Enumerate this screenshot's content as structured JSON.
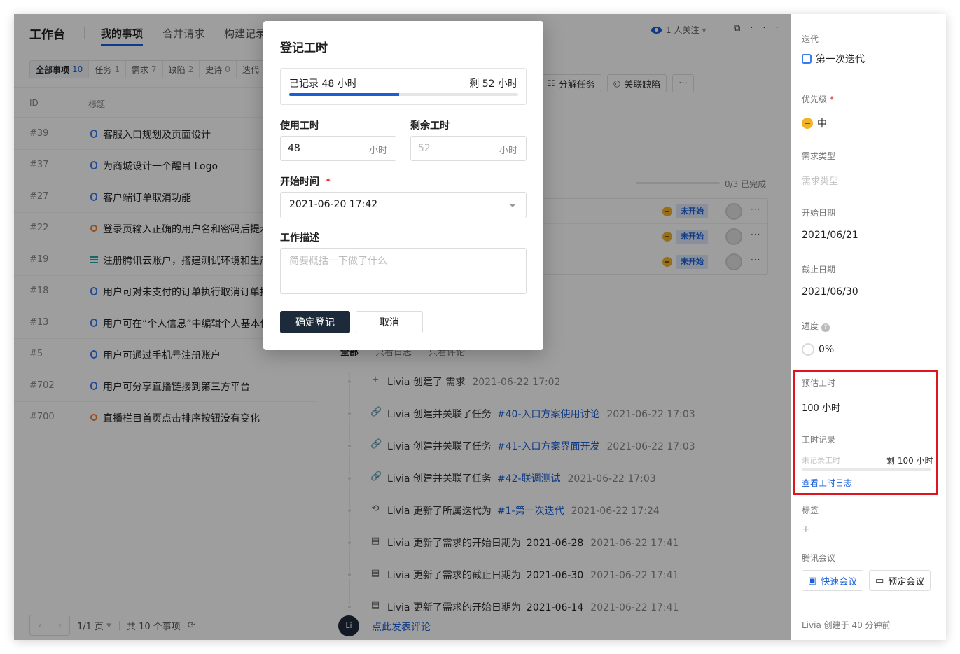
{
  "app": {
    "brand": "工作台"
  },
  "nav_tabs": [
    "我的事项",
    "合并请求",
    "构建记录"
  ],
  "filters": [
    {
      "label": "全部事项",
      "count": "10"
    },
    {
      "label": "任务",
      "count": "1"
    },
    {
      "label": "需求",
      "count": "7"
    },
    {
      "label": "缺陷",
      "count": "2"
    },
    {
      "label": "史诗",
      "count": "0"
    },
    {
      "label": "迭代",
      "count": ""
    }
  ],
  "table_header": {
    "id": "ID",
    "title": "标题"
  },
  "issues": [
    {
      "id": "#39",
      "type": "req",
      "title": "客服入口规划及页面设计"
    },
    {
      "id": "#37",
      "type": "req",
      "title": "为商城设计一个醒目 Logo"
    },
    {
      "id": "#27",
      "type": "req",
      "title": "客户端订单取消功能"
    },
    {
      "id": "#22",
      "type": "bug",
      "title": "登录页输入正确的用户名和密码后提示"
    },
    {
      "id": "#19",
      "type": "task",
      "title": "注册腾讯云账户，搭建测试环境和生产"
    },
    {
      "id": "#18",
      "type": "req",
      "title": "用户可对未支付的订单执行取消订单操"
    },
    {
      "id": "#13",
      "type": "req",
      "title": "用户可在“个人信息”中编辑个人基本信"
    },
    {
      "id": "#5",
      "type": "req",
      "title": "用户可通过手机号注册账户"
    },
    {
      "id": "#702",
      "type": "req",
      "title": "用户可分享直播链接到第三方平台"
    },
    {
      "id": "#700",
      "type": "bug",
      "title": "直播栏目首页点击排序按钮没有变化"
    }
  ],
  "pager": {
    "prev": "‹",
    "next": "›",
    "page": "1/1 页",
    "total": "共 10 个事项"
  },
  "detail": {
    "watchers": "1 人关注",
    "actions": [
      {
        "icon": "☷",
        "label": "分解任务"
      },
      {
        "icon": "◎",
        "label": "关联缺陷"
      },
      {
        "icon": "",
        "label": "···"
      }
    ],
    "subtask_progress": "0/3 已完成",
    "subtasks": [
      {
        "status": "未开始"
      },
      {
        "status": "未开始"
      },
      {
        "status": "未开始"
      }
    ],
    "feed_tabs": [
      "全部",
      "只看日志",
      "只看评论"
    ],
    "feed": [
      {
        "icon": "+",
        "text": "Livia 创建了 需求",
        "link": "",
        "value": "",
        "time": "2021-06-22 17:02"
      },
      {
        "icon": "🔗",
        "text": "Livia 创建并关联了任务",
        "link": "#40-入口方案使用讨论",
        "value": "",
        "time": "2021-06-22 17:03"
      },
      {
        "icon": "🔗",
        "text": "Livia 创建并关联了任务",
        "link": "#41-入口方案界面开发",
        "value": "",
        "time": "2021-06-22 17:03"
      },
      {
        "icon": "🔗",
        "text": "Livia 创建并关联了任务",
        "link": "#42-联调测试",
        "value": "",
        "time": "2021-06-22 17:03"
      },
      {
        "icon": "⟲",
        "text": "Livia 更新了所属迭代为",
        "link": "#1-第一次迭代",
        "value": "",
        "time": "2021-06-22 17:24"
      },
      {
        "icon": "▤",
        "text": "Livia 更新了需求的开始日期为",
        "link": "",
        "value": "2021-06-28",
        "time": "2021-06-22 17:41"
      },
      {
        "icon": "▤",
        "text": "Livia 更新了需求的截止日期为",
        "link": "",
        "value": "2021-06-30",
        "time": "2021-06-22 17:41"
      },
      {
        "icon": "▤",
        "text": "Livia 更新了需求的开始日期为",
        "link": "",
        "value": "2021-06-14",
        "time": "2021-06-22 17:41"
      }
    ],
    "comment_avatar": "Li",
    "comment_link": "点此发表评论"
  },
  "props": {
    "iteration_label": "迭代",
    "iteration_value": "第一次迭代",
    "priority_label": "优先级",
    "priority_value": "中",
    "req_type_label": "需求类型",
    "req_type_placeholder": "需求类型",
    "start_label": "开始日期",
    "start_value": "2021/06/21",
    "due_label": "截止日期",
    "due_value": "2021/06/30",
    "progress_label": "进度",
    "progress_value": "0%",
    "estimate_label": "预估工时",
    "estimate_value": "100 小时",
    "worklog_label": "工时记录",
    "worklog_unrecorded": "未记录工时",
    "worklog_remaining": "剩 100 小时",
    "worklog_link": "查看工时日志",
    "tags_label": "标签",
    "tags_add": "+",
    "meeting_label": "腾讯会议",
    "quick_meeting": "快速会议",
    "schedule_meeting": "预定会议",
    "footnote": "Livia 创建于 40 分钟前"
  },
  "modal": {
    "title": "登记工时",
    "recorded": "已记录 48 小时",
    "remaining": "剩 52 小时",
    "recorded_fraction": 0.48,
    "used_label": "使用工时",
    "used_value": "48",
    "used_unit": "小时",
    "remain_label": "剩余工时",
    "remain_placeholder": "52",
    "remain_unit": "小时",
    "start_label": "开始时间",
    "start_required": "*",
    "start_value": "2021-06-20 17:42",
    "desc_label": "工作描述",
    "desc_placeholder": "简要概括一下做了什么",
    "confirm": "确定登记",
    "cancel": "取消"
  },
  "colors": {
    "accent": "#1a5fd8",
    "primary_button": "#1d2a3a",
    "highlight": "#e0141e",
    "priority_medium": "#f0b429"
  }
}
